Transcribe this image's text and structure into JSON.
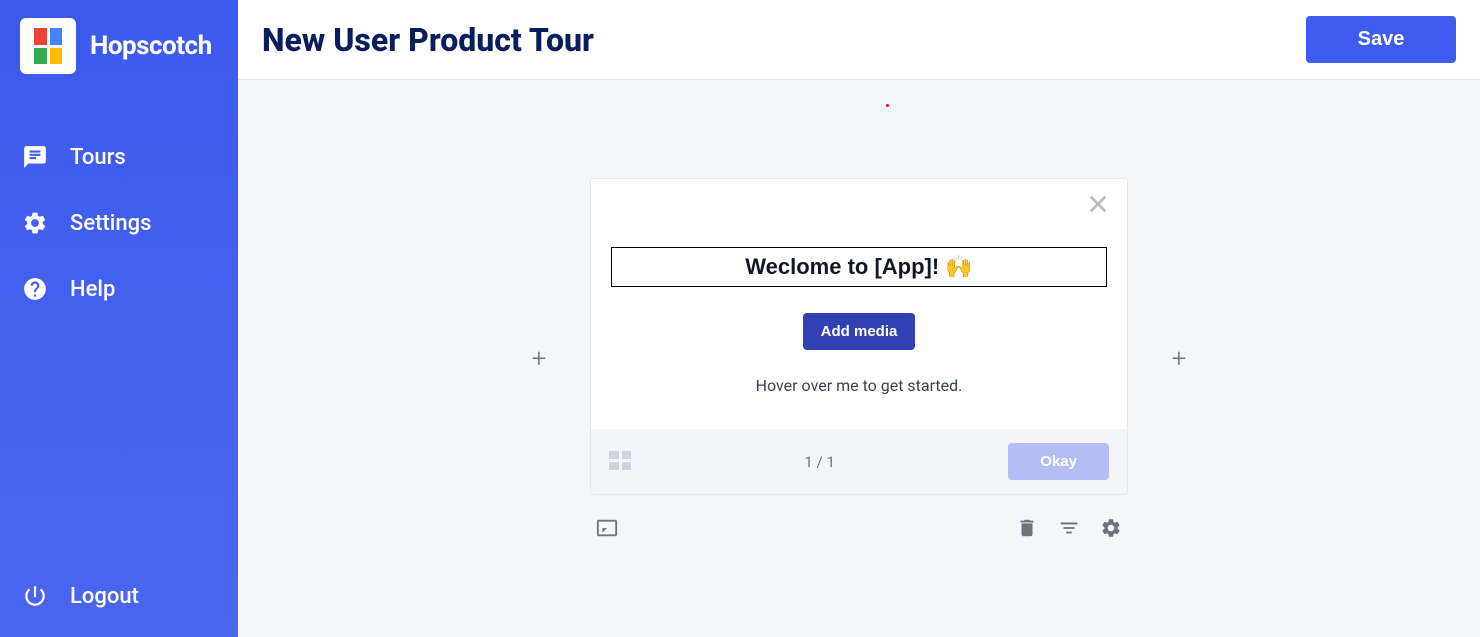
{
  "brand": {
    "name": "Hopscotch"
  },
  "sidebar": {
    "items": [
      {
        "label": "Tours"
      },
      {
        "label": "Settings"
      },
      {
        "label": "Help"
      }
    ],
    "logout_label": "Logout"
  },
  "header": {
    "title": "New User Product Tour",
    "save_label": "Save"
  },
  "card": {
    "title_value": "Weclome to [App]! 🙌",
    "add_media_label": "Add media",
    "hover_text": "Hover over me to get started.",
    "pager": "1 / 1",
    "okay_label": "Okay"
  }
}
